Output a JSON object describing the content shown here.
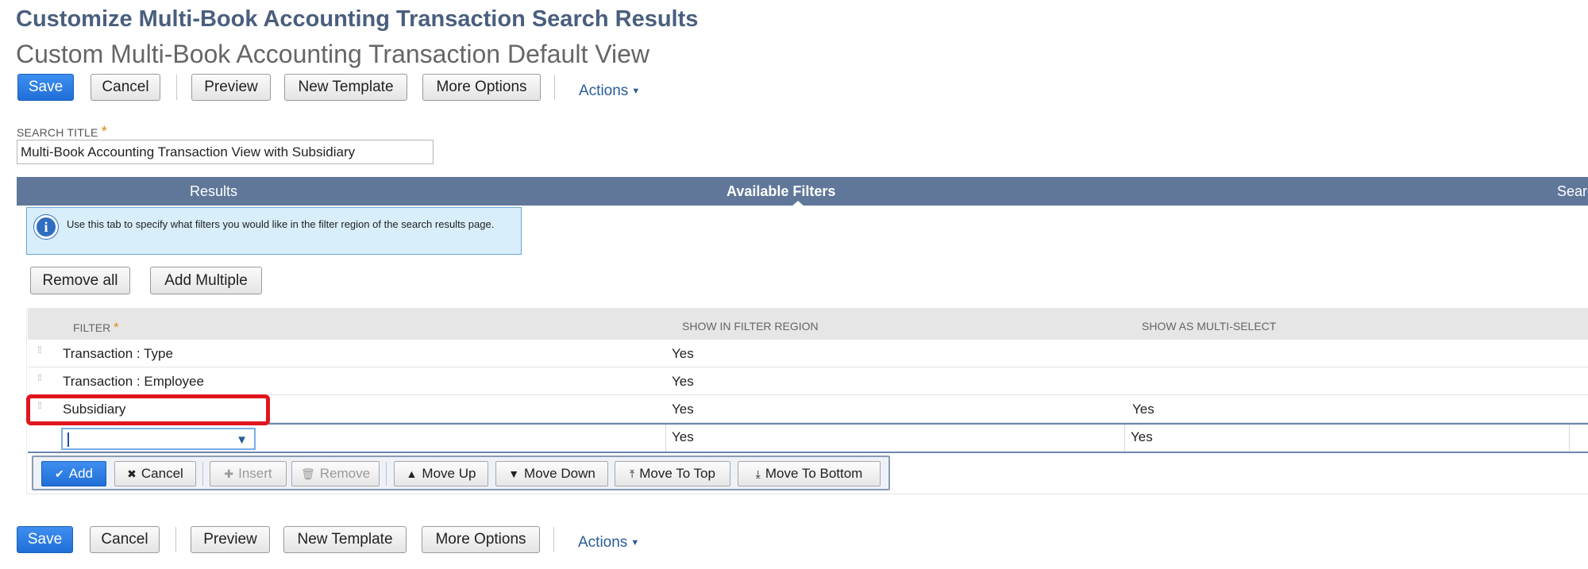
{
  "page": {
    "title": "Customize Multi-Book Accounting Transaction Search Results",
    "subtitle": "Custom Multi-Book Accounting Transaction Default View"
  },
  "toolbar": {
    "save": "Save",
    "cancel": "Cancel",
    "preview": "Preview",
    "new_template": "New Template",
    "more_options": "More Options",
    "actions": "Actions"
  },
  "search_title": {
    "label": "SEARCH TITLE",
    "required_mark": "*",
    "value": "Multi-Book Accounting Transaction View with Subsidiary"
  },
  "tabs": [
    {
      "label": "Results",
      "active": false
    },
    {
      "label": "Available Filters",
      "active": true
    },
    {
      "label": "Searc",
      "active": false
    }
  ],
  "info": {
    "icon": "info-icon",
    "text": "Use this tab to specify what filters you would like in the filter region of the search results page."
  },
  "filter_actions": {
    "remove_all": "Remove all",
    "add_multiple": "Add Multiple"
  },
  "grid": {
    "headers": {
      "filter": "FILTER",
      "filter_required": "*",
      "show_in_region": "SHOW IN FILTER REGION",
      "show_multi": "SHOW AS MULTI-SELECT"
    },
    "rows": [
      {
        "filter": "Transaction : Type",
        "show_in_region": "Yes",
        "show_multi": ""
      },
      {
        "filter": "Transaction : Employee",
        "show_in_region": "Yes",
        "show_multi": ""
      },
      {
        "filter": "Subsidiary",
        "show_in_region": "Yes",
        "show_multi": "Yes"
      }
    ],
    "edit_row": {
      "filter": "",
      "show_in_region": "Yes",
      "show_multi": "Yes"
    }
  },
  "row_toolbar": {
    "add": "Add",
    "cancel": "Cancel",
    "insert": "Insert",
    "remove": "Remove",
    "move_up": "Move Up",
    "move_down": "Move Down",
    "move_to_top": "Move To Top",
    "move_to_bottom": "Move To Bottom"
  },
  "colors": {
    "primary_button": "#1f6fd8",
    "tab_bar": "#607799",
    "highlight": "#e0161e",
    "title": "#4a5f7e"
  }
}
